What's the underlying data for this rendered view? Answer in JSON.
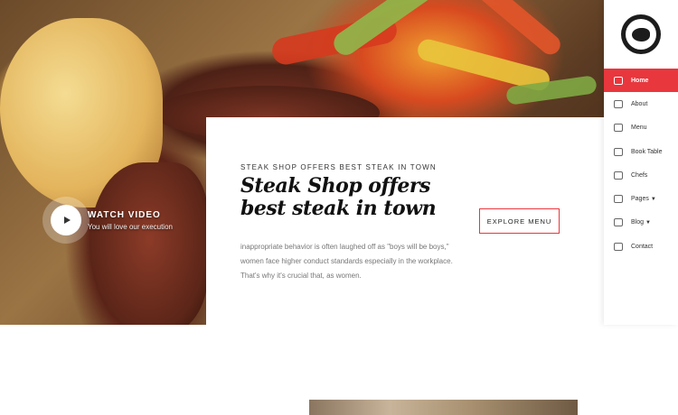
{
  "hero": {
    "video": {
      "title": "WATCH VIDEO",
      "subtitle": "You will love our execution"
    }
  },
  "panel": {
    "eyebrow": "STEAK SHOP OFFERS BEST STEAK IN TOWN",
    "heading": "Steak Shop offers best steak in town",
    "body": "inappropriate behavior is often laughed off as \"boys will be boys,\" women face higher conduct standards especially in the workplace. That's why it's crucial that, as women.",
    "cta": "EXPLORE MENU"
  },
  "sidebar": {
    "logo": "Steak Shop",
    "items": [
      {
        "label": "Home",
        "icon": "home-icon",
        "active": true
      },
      {
        "label": "About",
        "icon": "person-icon"
      },
      {
        "label": "Menu",
        "icon": "menu-board-icon"
      },
      {
        "label": "Book Table",
        "icon": "table-icon"
      },
      {
        "label": "Chefs",
        "icon": "chef-icon"
      },
      {
        "label": "Pages",
        "icon": "utensils-icon",
        "dropdown": true
      },
      {
        "label": "Blog",
        "icon": "blog-icon",
        "dropdown": true
      },
      {
        "label": "Contact",
        "icon": "contact-icon"
      }
    ]
  },
  "colors": {
    "accent": "#e8373d",
    "text_dark": "#111111",
    "text_muted": "#777777"
  }
}
